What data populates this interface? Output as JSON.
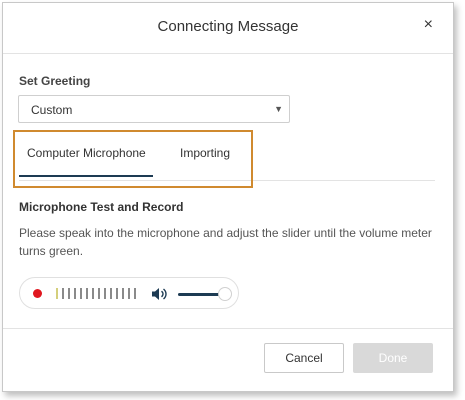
{
  "dialog": {
    "title": "Connecting Message",
    "close_icon": "close-icon",
    "close_glyph": "×"
  },
  "greeting": {
    "label": "Set Greeting",
    "selected": "Custom"
  },
  "tabs": [
    {
      "label": "Computer Microphone",
      "active": true
    },
    {
      "label": "Importing",
      "active": false
    }
  ],
  "microphone": {
    "title": "Microphone Test and Record",
    "description": "Please speak into the microphone and adjust the slider until the volume meter turns green.",
    "record_icon": "record-icon",
    "speaker_icon": "speaker-icon",
    "volume_level": 0.85
  },
  "footer": {
    "cancel_label": "Cancel",
    "done_label": "Done"
  },
  "colors": {
    "highlight": "#d08a2f",
    "accent": "#1d3b53",
    "record": "#e0171f"
  }
}
